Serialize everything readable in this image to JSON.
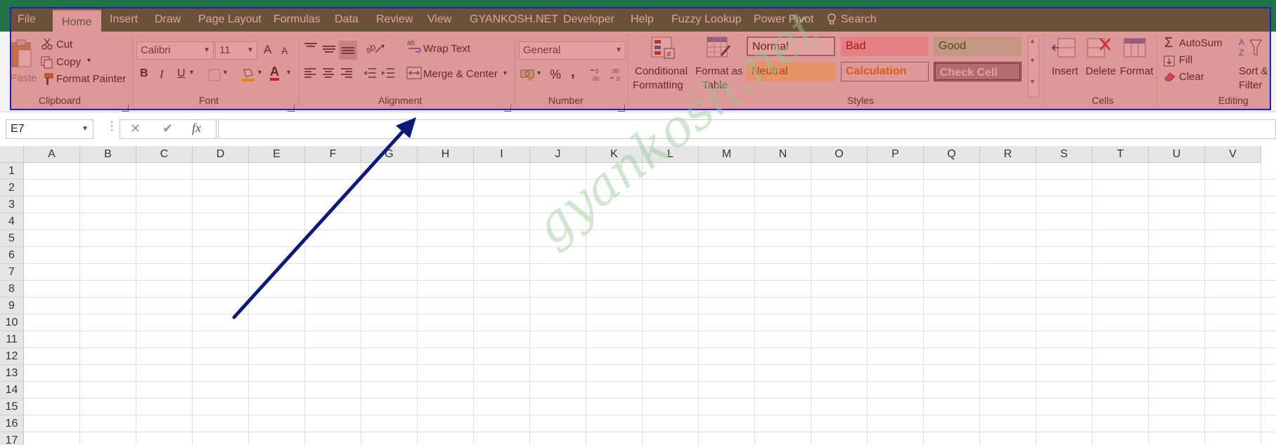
{
  "tabs": [
    {
      "label": "File"
    },
    {
      "label": "Home"
    },
    {
      "label": "Insert"
    },
    {
      "label": "Draw"
    },
    {
      "label": "Page Layout"
    },
    {
      "label": "Formulas"
    },
    {
      "label": "Data"
    },
    {
      "label": "Review"
    },
    {
      "label": "View"
    },
    {
      "label": "GYANKOSH.NET"
    },
    {
      "label": "Developer"
    },
    {
      "label": "Help"
    },
    {
      "label": "Fuzzy Lookup"
    },
    {
      "label": "Power Pivot"
    },
    {
      "label": "Search"
    }
  ],
  "clipboard": {
    "paste": "Paste",
    "cut": "Cut",
    "copy": "Copy",
    "format_painter": "Format Painter",
    "label": "Clipboard"
  },
  "font": {
    "name": "Calibri",
    "size": "11",
    "label": "Font",
    "bold": "B",
    "italic": "I",
    "underline": "U",
    "grow": "A",
    "shrink": "A",
    "color_letter": "A"
  },
  "alignment": {
    "wrap_text": "Wrap Text",
    "merge_center": "Merge & Center",
    "label": "Alignment"
  },
  "number": {
    "format": "General",
    "percent": "%",
    "comma": ",",
    "label": "Number"
  },
  "styles_group": {
    "conditional": [
      "Conditional",
      "Formatting"
    ],
    "format_as": [
      "Format as",
      "Table"
    ],
    "normal": "Normal",
    "bad": "Bad",
    "good": "Good",
    "neutral": "Neutral",
    "calculation": "Calculation",
    "check_cell": "Check Cell",
    "label": "Styles"
  },
  "cells": {
    "insert": "Insert",
    "delete": "Delete",
    "format": "Format",
    "label": "Cells"
  },
  "editing": {
    "autosum": "AutoSum",
    "fill": "Fill",
    "clear": "Clear",
    "sort": [
      "Sort &",
      "Filter"
    ],
    "label": "Editing"
  },
  "formula_bar": {
    "name_box": "E7",
    "fx": "fx",
    "cancel": "✕",
    "enter": "✔"
  },
  "columns": [
    "A",
    "B",
    "C",
    "D",
    "E",
    "F",
    "G",
    "H",
    "I",
    "J",
    "K",
    "L",
    "M",
    "N",
    "O",
    "P",
    "Q",
    "R",
    "S",
    "T",
    "U",
    "V"
  ],
  "rows": [
    "1",
    "2",
    "3",
    "4",
    "5",
    "6",
    "7",
    "8",
    "9",
    "10",
    "11",
    "12",
    "13",
    "14",
    "15",
    "16",
    "17"
  ],
  "watermark": "gyankosh.net",
  "colors": {
    "excel_green": "#217346",
    "highlight": "#c42a2a",
    "arrow": "#0c1a7a",
    "border_blue": "#1f1fbf"
  }
}
